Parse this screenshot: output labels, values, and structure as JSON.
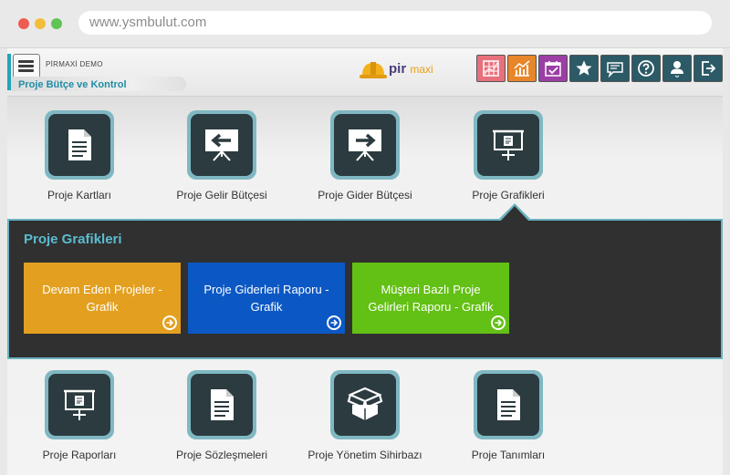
{
  "browser": {
    "url": "www.ysmbulut.com"
  },
  "header": {
    "company": "PİRMAXİ DEMO",
    "module_title": "Proje Bütçe ve Kontrol",
    "logo": {
      "pir": "pir",
      "maxi": "maxi"
    }
  },
  "toolbar": {
    "buttons": [
      {
        "icon": "chart-grid-icon",
        "color": "#e8707d"
      },
      {
        "icon": "line-chart-icon",
        "color": "#e8862a"
      },
      {
        "icon": "calendar-check-icon",
        "color": "#9b3ea6"
      },
      {
        "icon": "star-icon",
        "color": "#2c5a66"
      },
      {
        "icon": "message-icon",
        "color": "#2c5a66"
      },
      {
        "icon": "help-icon",
        "color": "#2c5a66"
      },
      {
        "icon": "user-icon",
        "color": "#2c5a66"
      },
      {
        "icon": "logout-icon",
        "color": "#2c5a66"
      }
    ]
  },
  "tiles_top": [
    {
      "label": "Proje Kartları",
      "icon": "document-icon"
    },
    {
      "label": "Proje Gelir Bütçesi",
      "icon": "board-arrow-left-icon"
    },
    {
      "label": "Proje Gider Bütçesi",
      "icon": "board-arrow-right-icon"
    },
    {
      "label": "Proje Grafikleri",
      "icon": "presentation-icon"
    }
  ],
  "panel": {
    "title": "Proje Grafikleri",
    "cards": [
      {
        "label": "Devam Eden Projeler - Grafik",
        "color": "#e3a020"
      },
      {
        "label": "Proje Giderleri Raporu - Grafik",
        "color": "#0b58c5"
      },
      {
        "label": "Müşteri Bazlı Proje Gelirleri Raporu - Grafik",
        "color": "#63c014"
      }
    ]
  },
  "tiles_bottom": [
    {
      "label": "Proje Raporları",
      "icon": "presentation-icon"
    },
    {
      "label": "Proje Sözleşmeleri",
      "icon": "document-icon"
    },
    {
      "label": "Proje Yönetim Sihirbazı",
      "icon": "open-box-icon"
    },
    {
      "label": "Proje Tanımları",
      "icon": "document-icon"
    }
  ],
  "colors": {
    "accent": "#23a3b8",
    "panel_bg": "#303030",
    "tile_bg": "#2b3b3f"
  }
}
